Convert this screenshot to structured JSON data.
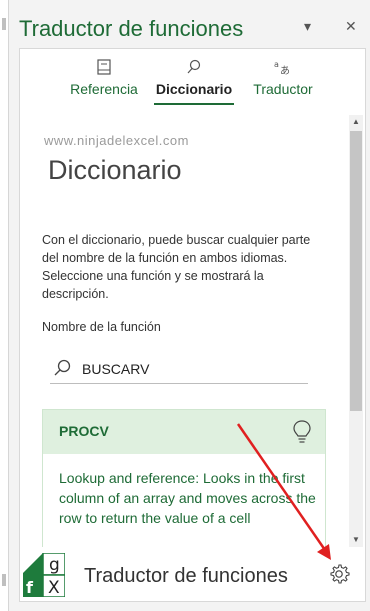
{
  "header": {
    "title": "Traductor de funciones",
    "dropdown_glyph": "▾",
    "close_glyph": "✕"
  },
  "tabs": [
    {
      "label": "Referencia",
      "icon": "book-icon",
      "active": false
    },
    {
      "label": "Diccionario",
      "icon": "search-icon",
      "active": true
    },
    {
      "label": "Traductor",
      "icon": "translate-icon",
      "active": false
    }
  ],
  "panel": {
    "watermark": "www.ninjadelexcel.com",
    "title": "Diccionario",
    "description": "Con el diccionario, puede buscar cualquier parte del nombre de la función en ambos idiomas. Seleccione una función y se mostrará la descripción.",
    "field_label": "Nombre de la función",
    "search_value": "BUSCARV",
    "result": {
      "name": "PROCV",
      "description": "Lookup and reference: Looks in the first column of an array and moves across the row to return the value of a cell"
    }
  },
  "footer": {
    "title": "Traductor de funciones",
    "logo_letters": [
      "g",
      "f",
      "X"
    ]
  },
  "colors": {
    "accent": "#1e6b36",
    "result_header": "#dff0df",
    "annotation_arrow": "#e02020"
  }
}
